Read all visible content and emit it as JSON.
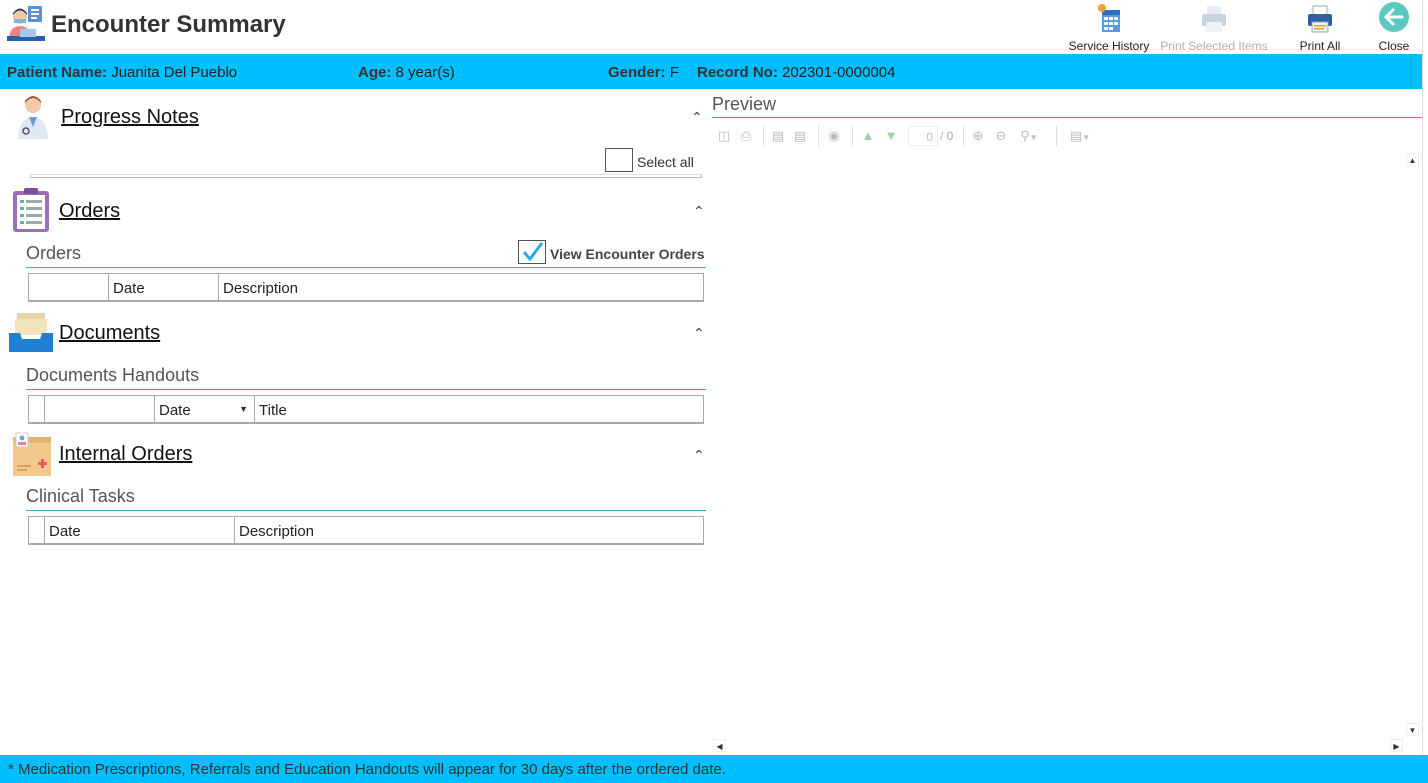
{
  "header": {
    "title": "Encounter Summary",
    "buttons": {
      "service_history": "Service History",
      "print_selected": "Print Selected Items",
      "print_all": "Print All",
      "close": "Close"
    }
  },
  "patient": {
    "name_label": "Patient Name:",
    "name": "Juanita Del Pueblo",
    "age_label": "Age:",
    "age": "8 year(s)",
    "gender_label": "Gender:",
    "gender": "F",
    "record_label": "Record No:",
    "record": "202301-0000004"
  },
  "sections": {
    "progress_notes": {
      "title": "Progress Notes",
      "select_all": "Select all"
    },
    "orders": {
      "title": "Orders",
      "group_title": "Orders",
      "view_encounter_orders": "View Encounter Orders",
      "view_encounter_orders_checked": true,
      "columns": [
        "",
        "Date",
        "Description"
      ]
    },
    "documents": {
      "title": "Documents",
      "group_title": "Documents Handouts",
      "columns": [
        "",
        "",
        "Date",
        "Title"
      ]
    },
    "internal_orders": {
      "title": "Internal Orders",
      "group_title": "Clinical Tasks",
      "columns": [
        "",
        "Date",
        "Description"
      ]
    }
  },
  "preview": {
    "title": "Preview",
    "page_current": "0",
    "page_total": "/ 0"
  },
  "footer": {
    "note": "* Medication Prescriptions, Referrals and Education Handouts will appear for 30 days after the ordered date."
  },
  "colors": {
    "accent_bar": "#00bfff",
    "group_line": "#3aa9e0"
  }
}
